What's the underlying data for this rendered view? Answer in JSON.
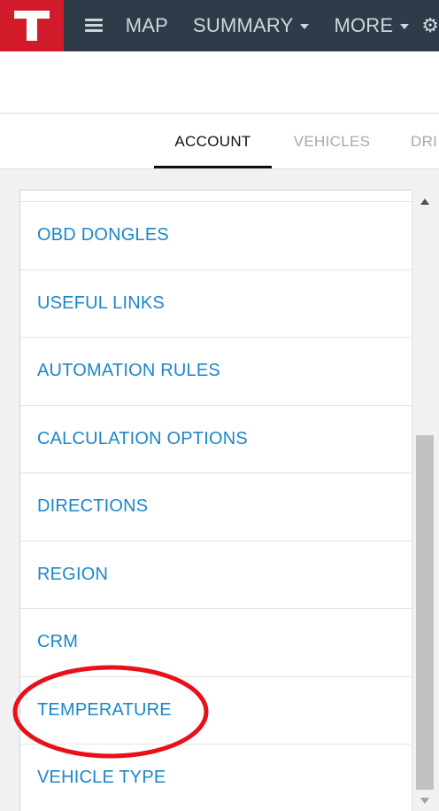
{
  "topbar": {
    "logo_letter": "T",
    "brand_color": "#d11a2a",
    "bar_color": "#2f3b49",
    "menu_icon": "hamburger-icon",
    "items": [
      {
        "label": "MAP",
        "dropdown": false
      },
      {
        "label": "SUMMARY",
        "dropdown": true
      },
      {
        "label": "MORE",
        "dropdown": true
      }
    ],
    "settings_icon": "gear-icon"
  },
  "tabs": [
    {
      "label": "ACCOUNT",
      "active": true
    },
    {
      "label": "VEHICLES",
      "active": false
    },
    {
      "label": "DRI",
      "active": false
    }
  ],
  "settings_list": {
    "link_color": "#1b87c9",
    "items": [
      "OBD DONGLES",
      "USEFUL LINKS",
      "AUTOMATION RULES",
      "CALCULATION OPTIONS",
      "DIRECTIONS",
      "REGION",
      "CRM",
      "TEMPERATURE",
      "VEHICLE TYPE"
    ],
    "highlighted_item": "TEMPERATURE",
    "highlight_color": "#e8101a"
  }
}
